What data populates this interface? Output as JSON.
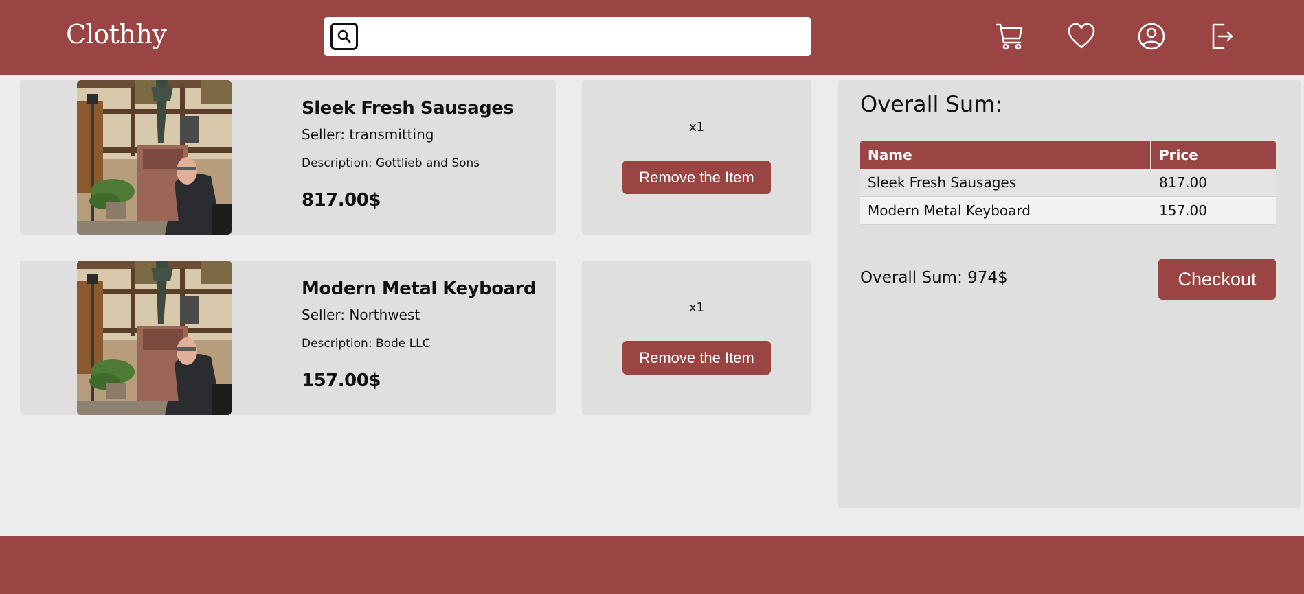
{
  "header": {
    "logo": "Clothhy",
    "search": {
      "value": "",
      "placeholder": ""
    },
    "icons": [
      "cart-icon",
      "heart-icon",
      "user-icon",
      "logout-icon"
    ]
  },
  "cart": {
    "items": [
      {
        "name": "Sleek Fresh Sausages",
        "seller": "Seller: transmitting",
        "description": "Description: Gottlieb and Sons",
        "price": "817.00$",
        "quantity": "x1",
        "remove_label": "Remove the Item"
      },
      {
        "name": "Modern Metal Keyboard",
        "seller": "Seller: Northwest",
        "description": "Description: Bode LLC",
        "price": "157.00$",
        "quantity": "x1",
        "remove_label": "Remove the Item"
      }
    ]
  },
  "summary": {
    "title": "Overall Sum:",
    "columns": [
      "Name",
      "Price"
    ],
    "rows": [
      [
        "Sleek Fresh Sausages",
        "817.00"
      ],
      [
        "Modern Metal Keyboard",
        "157.00"
      ]
    ],
    "total": "Overall Sum: 974$",
    "checkout_label": "Checkout"
  },
  "colors": {
    "brand": "#9a4444",
    "background": "#ececec",
    "card": "#dfdfdf"
  }
}
